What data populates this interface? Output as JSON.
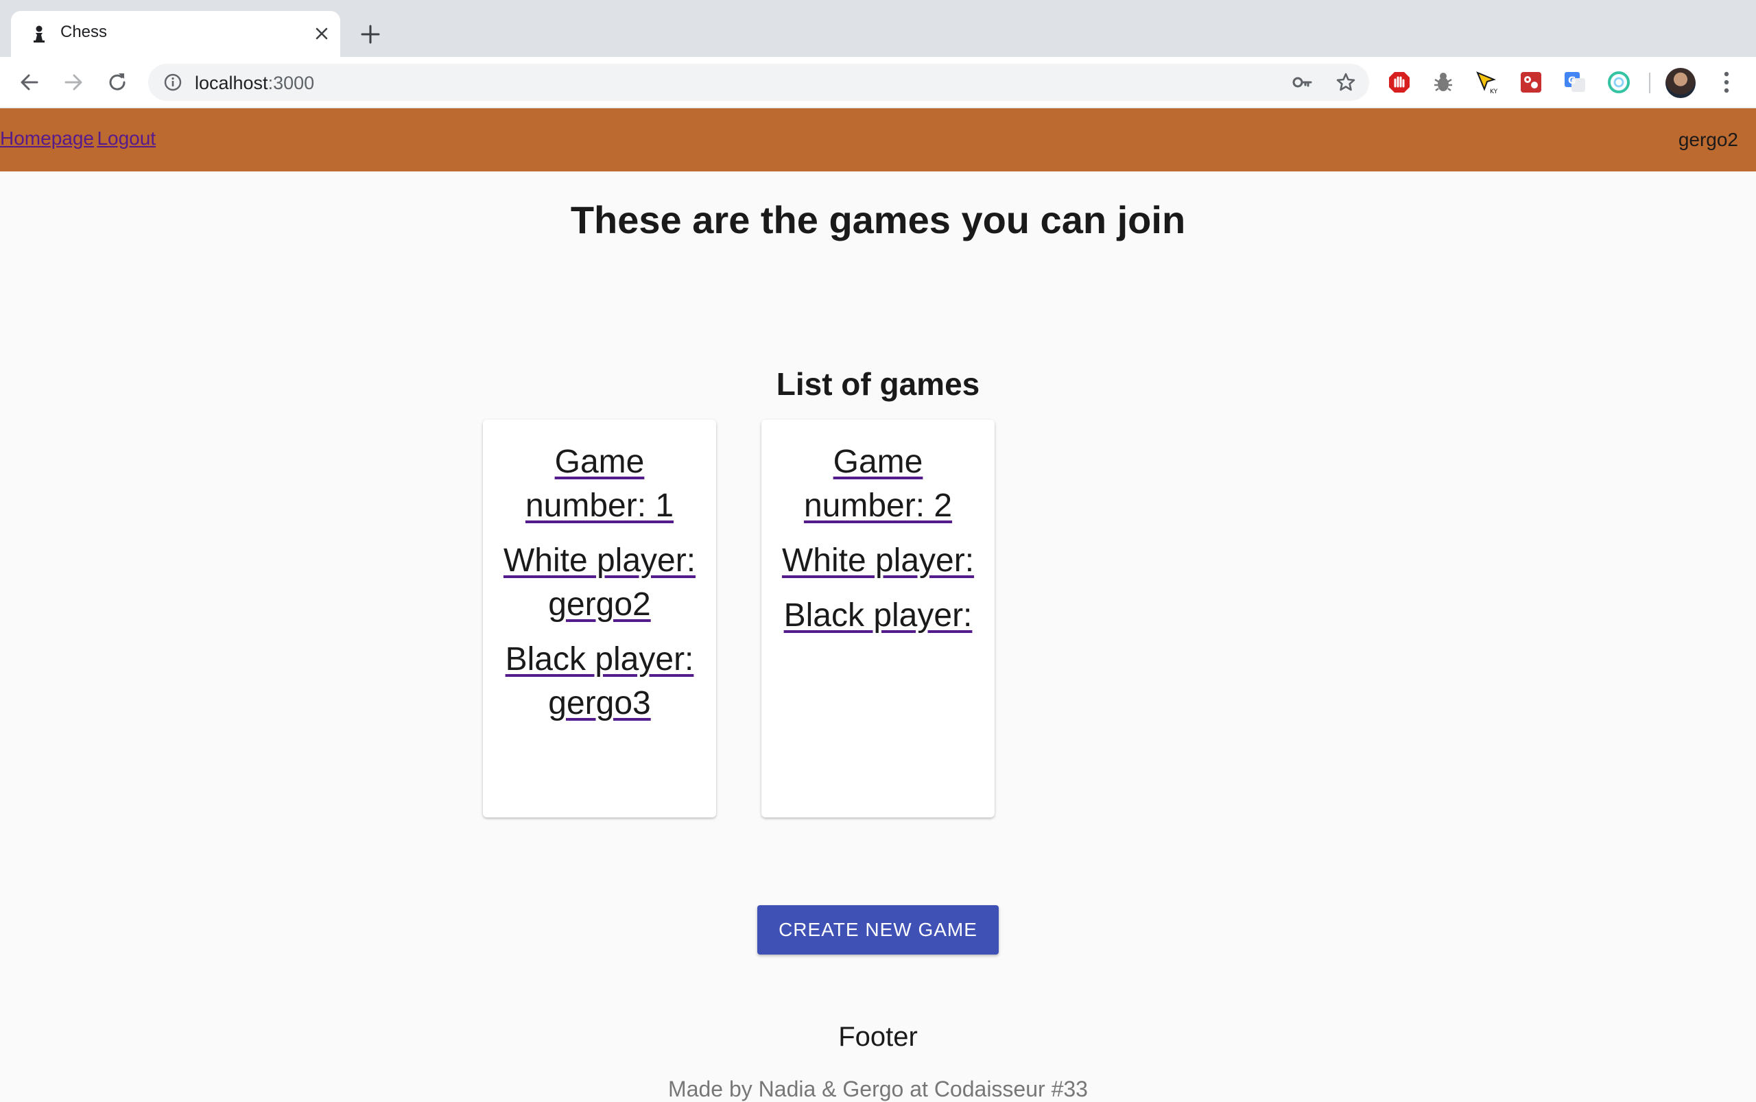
{
  "browser": {
    "tab_title": "Chess",
    "url_host": "localhost",
    "url_port": ":3000",
    "icons": [
      "chess-pawn-icon",
      "close-icon",
      "plus-icon",
      "back-icon",
      "forward-icon",
      "reload-icon",
      "info-icon",
      "key-icon",
      "star-icon",
      "ublock-icon",
      "bug-icon",
      "cursor-icon",
      "extension-icon",
      "translate-icon",
      "circle-extension-icon",
      "avatar",
      "menu-dots-icon"
    ]
  },
  "header": {
    "homepage_label": "Homepage",
    "logout_label": "Logout",
    "username": "gergo2",
    "background_color": "#bd6a30"
  },
  "main": {
    "title": "These are the games you can join",
    "list_title": "List of games",
    "games": [
      {
        "game_number": "Game number: 1",
        "white_player": "White player: gergo2",
        "black_player": "Black player: gergo3"
      },
      {
        "game_number": "Game number: 2",
        "white_player": "White player:",
        "black_player": "Black player:"
      }
    ],
    "create_button_label": "CREATE NEW GAME",
    "button_color": "#3f51b5"
  },
  "footer": {
    "title": "Footer",
    "credit": "Made by Nadia & Gergo at Codaisseur #33"
  }
}
